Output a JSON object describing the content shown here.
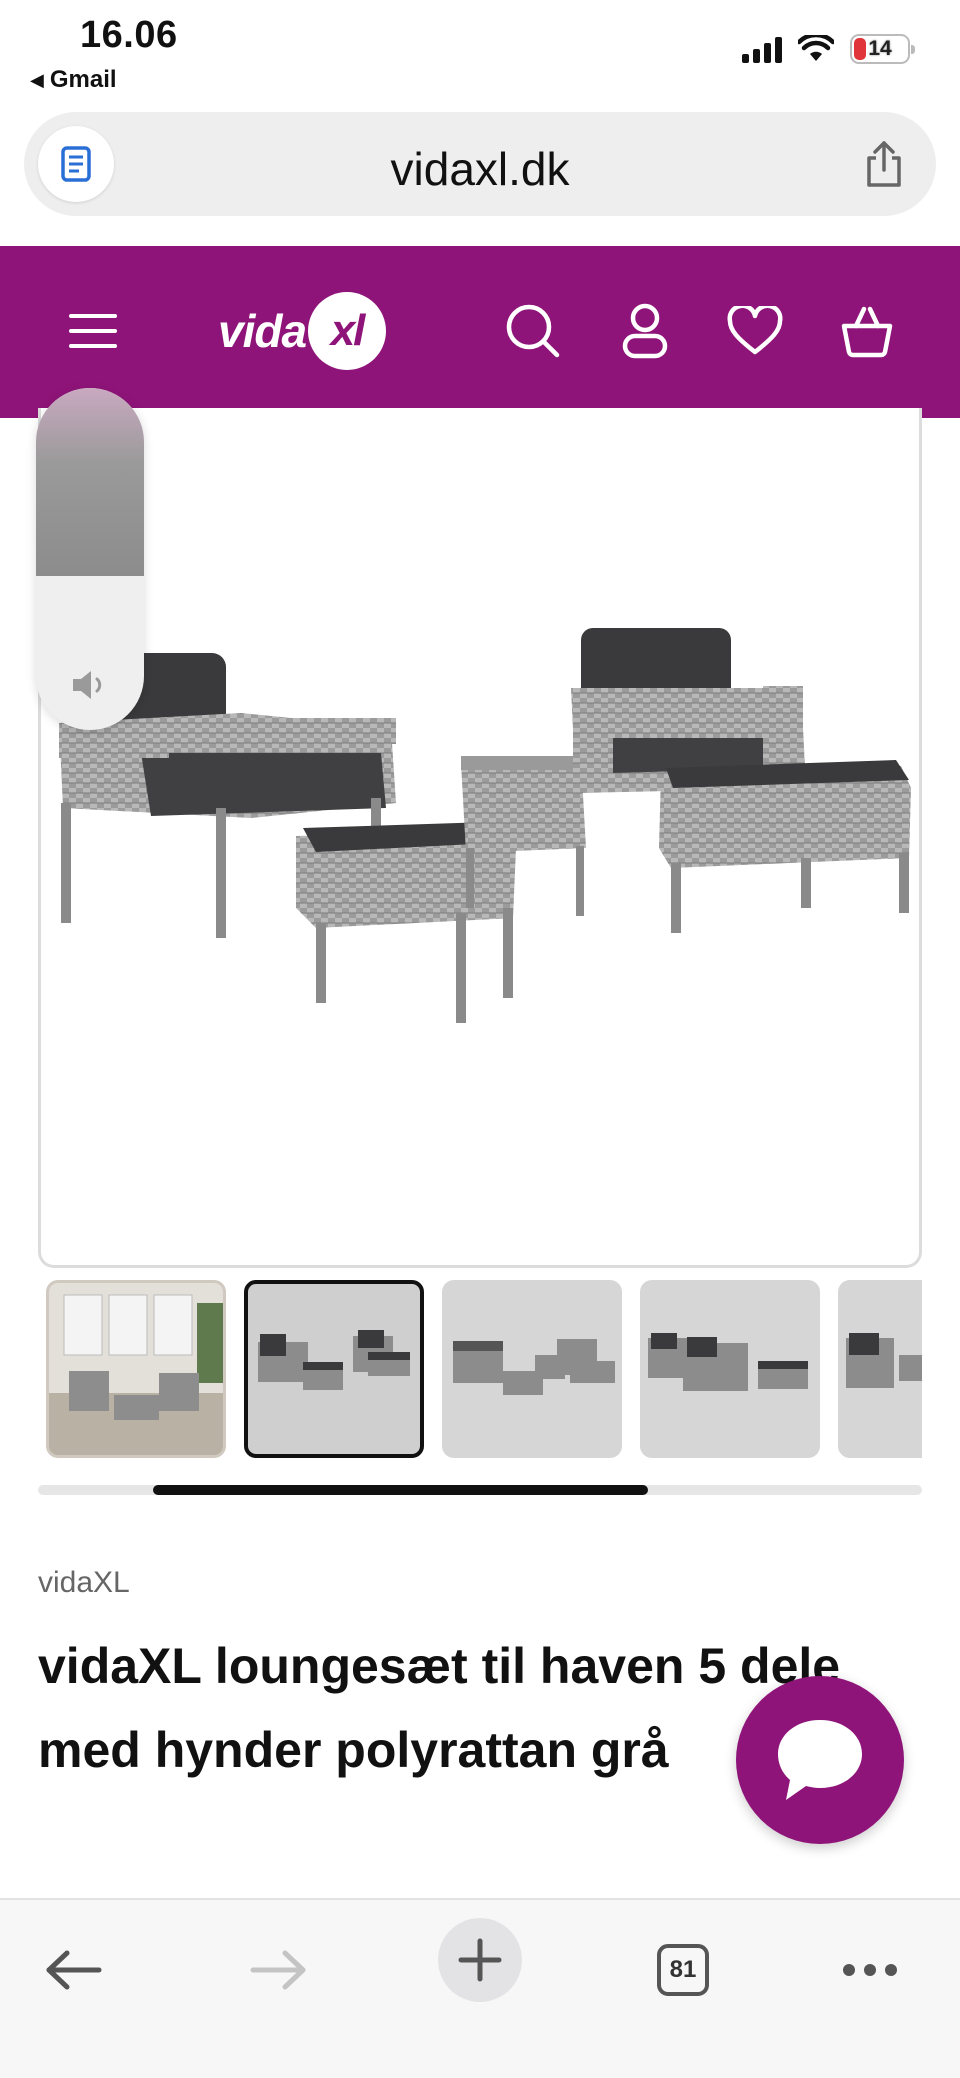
{
  "status_bar": {
    "time": "16.06",
    "back_app": "Gmail",
    "battery_level": "14"
  },
  "browser": {
    "url": "vidaxl.dk",
    "tabs_count": "81"
  },
  "site": {
    "logo_text": "vida",
    "logo_badge": "xl",
    "brand_color": "#8f1479"
  },
  "product": {
    "brand": "vidaXL",
    "title": "vidaXL loungesæt til haven 5 dele med hynder polyrattan grå",
    "thumbnail_count": 5,
    "active_thumbnail": 2,
    "gallery_scroll_start": 0.13,
    "gallery_scroll_extent": 0.56
  },
  "volume": {
    "level": 0.55
  },
  "icons": {
    "menu": "hamburger-menu-icon",
    "search": "search-icon",
    "account": "user-icon",
    "wishlist": "heart-icon",
    "cart": "basket-icon",
    "chat": "chat-bubble-icon"
  }
}
